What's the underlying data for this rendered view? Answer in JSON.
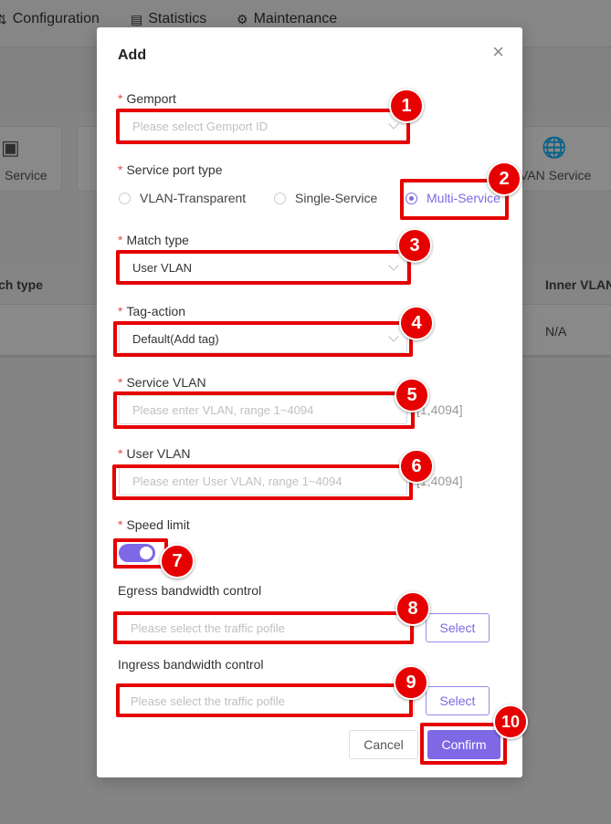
{
  "background": {
    "nav_tabs": [
      {
        "icon": "sliders-icon",
        "label": "Configuration"
      },
      {
        "icon": "chart-icon",
        "label": "Statistics"
      },
      {
        "icon": "gear-icon",
        "label": "Maintenance"
      }
    ],
    "service_cards": [
      {
        "label": "Service"
      },
      {
        "label": "VAN Service"
      }
    ],
    "table": {
      "headers": [
        "ch type",
        "Inner VLAN"
      ],
      "row": [
        "-",
        "N/A"
      ]
    }
  },
  "modal": {
    "title": "Add",
    "close_symbol": "×",
    "gemport": {
      "label": "Gemport",
      "placeholder": "Please select Gemport ID"
    },
    "service_port_type": {
      "label": "Service port type",
      "options": [
        "VLAN-Transparent",
        "Single-Service",
        "Multi-Service"
      ],
      "selected": "Multi-Service"
    },
    "match_type": {
      "label": "Match type",
      "value": "User VLAN"
    },
    "tag_action": {
      "label": "Tag-action",
      "value": "Default(Add tag)"
    },
    "service_vlan": {
      "label": "Service VLAN",
      "placeholder": "Please enter VLAN, range 1~4094",
      "suffix": "[1,4094]"
    },
    "user_vlan": {
      "label": "User VLAN",
      "placeholder": "Please enter User VLAN, range 1~4094",
      "suffix": "[1,4094]"
    },
    "speed_limit": {
      "label": "Speed limit",
      "enabled": true
    },
    "egress": {
      "label": "Egress bandwidth control",
      "placeholder": "Please select the traffic pofile",
      "button": "Select"
    },
    "ingress": {
      "label": "Ingress bandwidth control",
      "placeholder": "Please select the traffic pofile",
      "button": "Select"
    },
    "cancel": "Cancel",
    "confirm": "Confirm"
  },
  "callouts": [
    "1",
    "2",
    "3",
    "4",
    "5",
    "6",
    "7",
    "8",
    "9",
    "10"
  ],
  "colors": {
    "accent": "#7e68e6",
    "annotation": "#e60000",
    "required": "#e34d4d"
  }
}
